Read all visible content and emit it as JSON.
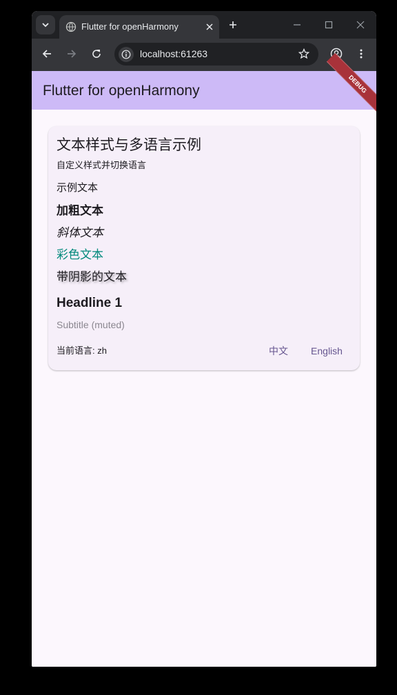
{
  "browser": {
    "tab_title": "Flutter for openHarmony",
    "url": "localhost:61263",
    "icons": [
      "tab-search-icon",
      "globe-icon",
      "close-icon",
      "plus-icon",
      "minimize-icon",
      "maximize-icon",
      "window-close-icon",
      "back-icon",
      "forward-icon",
      "reload-icon",
      "site-info-icon",
      "star-icon",
      "profile-icon",
      "more-vert-icon"
    ]
  },
  "app": {
    "title": "Flutter for openHarmony",
    "debug_banner": "DEBUG",
    "colors": {
      "appbar": "#cdbaf7",
      "accent_text": "#00897b",
      "button_text": "#65558f",
      "debug_banner": "#a8323a"
    },
    "card": {
      "title": "文本样式与多语言示例",
      "subtitle": "自定义样式并切换语言",
      "sample_text": "示例文本",
      "bold_text": "加粗文本",
      "italic_text": "斜体文本",
      "colored_text": "彩色文本",
      "shadow_text": "带阴影的文本",
      "headline": "Headline 1",
      "muted_subtitle": "Subtitle (muted)",
      "current_language": "当前语言: zh",
      "button_zh": "中文",
      "button_en": "English"
    }
  }
}
